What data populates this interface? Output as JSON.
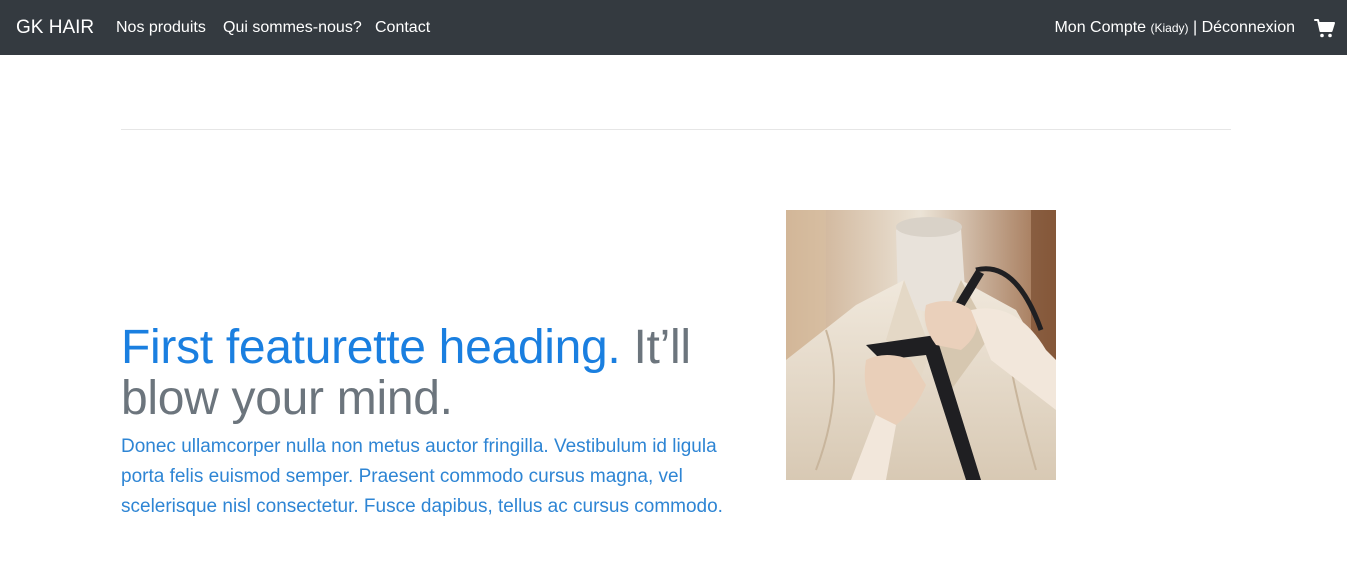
{
  "navbar": {
    "brand": "GK HAIR",
    "links": [
      "Nos produits",
      "Qui sommes-nous?",
      "Contact"
    ],
    "account_label": "Mon Compte",
    "account_user": "(Kiady)",
    "separator": "|",
    "logout_label": "Déconnexion",
    "cart_icon": "cart-icon",
    "background": "#343a40"
  },
  "featurette": {
    "heading_accent": "First featurette heading.",
    "heading_rest": "It’ll blow your mind.",
    "lead": "Donec ullamcorper nulla non metus auctor fringilla. Vestibulum id ligula porta felis euismod semper. Praesent commodo cursus magna, vel scelerisque nisl consectetur. Fusce dapibus, tellus ac cursus commodo.",
    "accent_color": "#1a7fe0",
    "heading_color": "#6c757d"
  }
}
